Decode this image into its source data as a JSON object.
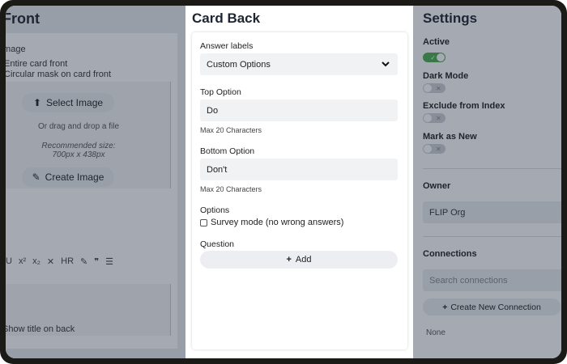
{
  "left": {
    "title": "Front",
    "image_label": "Image",
    "opt_entire": "Entire card front",
    "opt_circular": "Circular mask on card front",
    "select_image": "Select Image",
    "drag_drop": "Or drag and drop a file",
    "recommended": "Recommended size: 700px x 438px",
    "create_image": "Create Image",
    "toolbar": [
      "U",
      "x²",
      "x₂",
      "✕",
      "HR",
      "✎",
      "❞",
      "☰"
    ],
    "show_title_back": "Show title on back"
  },
  "center": {
    "title": "Card Back",
    "answer_labels": "Answer labels",
    "answer_select_value": "Custom Options",
    "top_option_label": "Top Option",
    "top_option_value": "Do",
    "top_hint": "Max 20 Characters",
    "bottom_option_label": "Bottom Option",
    "bottom_option_value": "Don't",
    "bottom_hint": "Max 20 Characters",
    "options_label": "Options",
    "survey_mode": "Survey mode (no wrong answers)",
    "question_label": "Question",
    "add_label": "Add"
  },
  "right": {
    "title": "Settings",
    "active": "Active",
    "dark_mode": "Dark Mode",
    "exclude": "Exclude from Index",
    "mark_new": "Mark as New",
    "owner_label": "Owner",
    "owner_value": "FLIP Org",
    "connections_label": "Connections",
    "search_placeholder": "Search connections",
    "create_connection": "Create New Connection",
    "none": "None"
  },
  "colors": {
    "toggle_on": "#4caf50",
    "overlay": "#1e283c"
  }
}
